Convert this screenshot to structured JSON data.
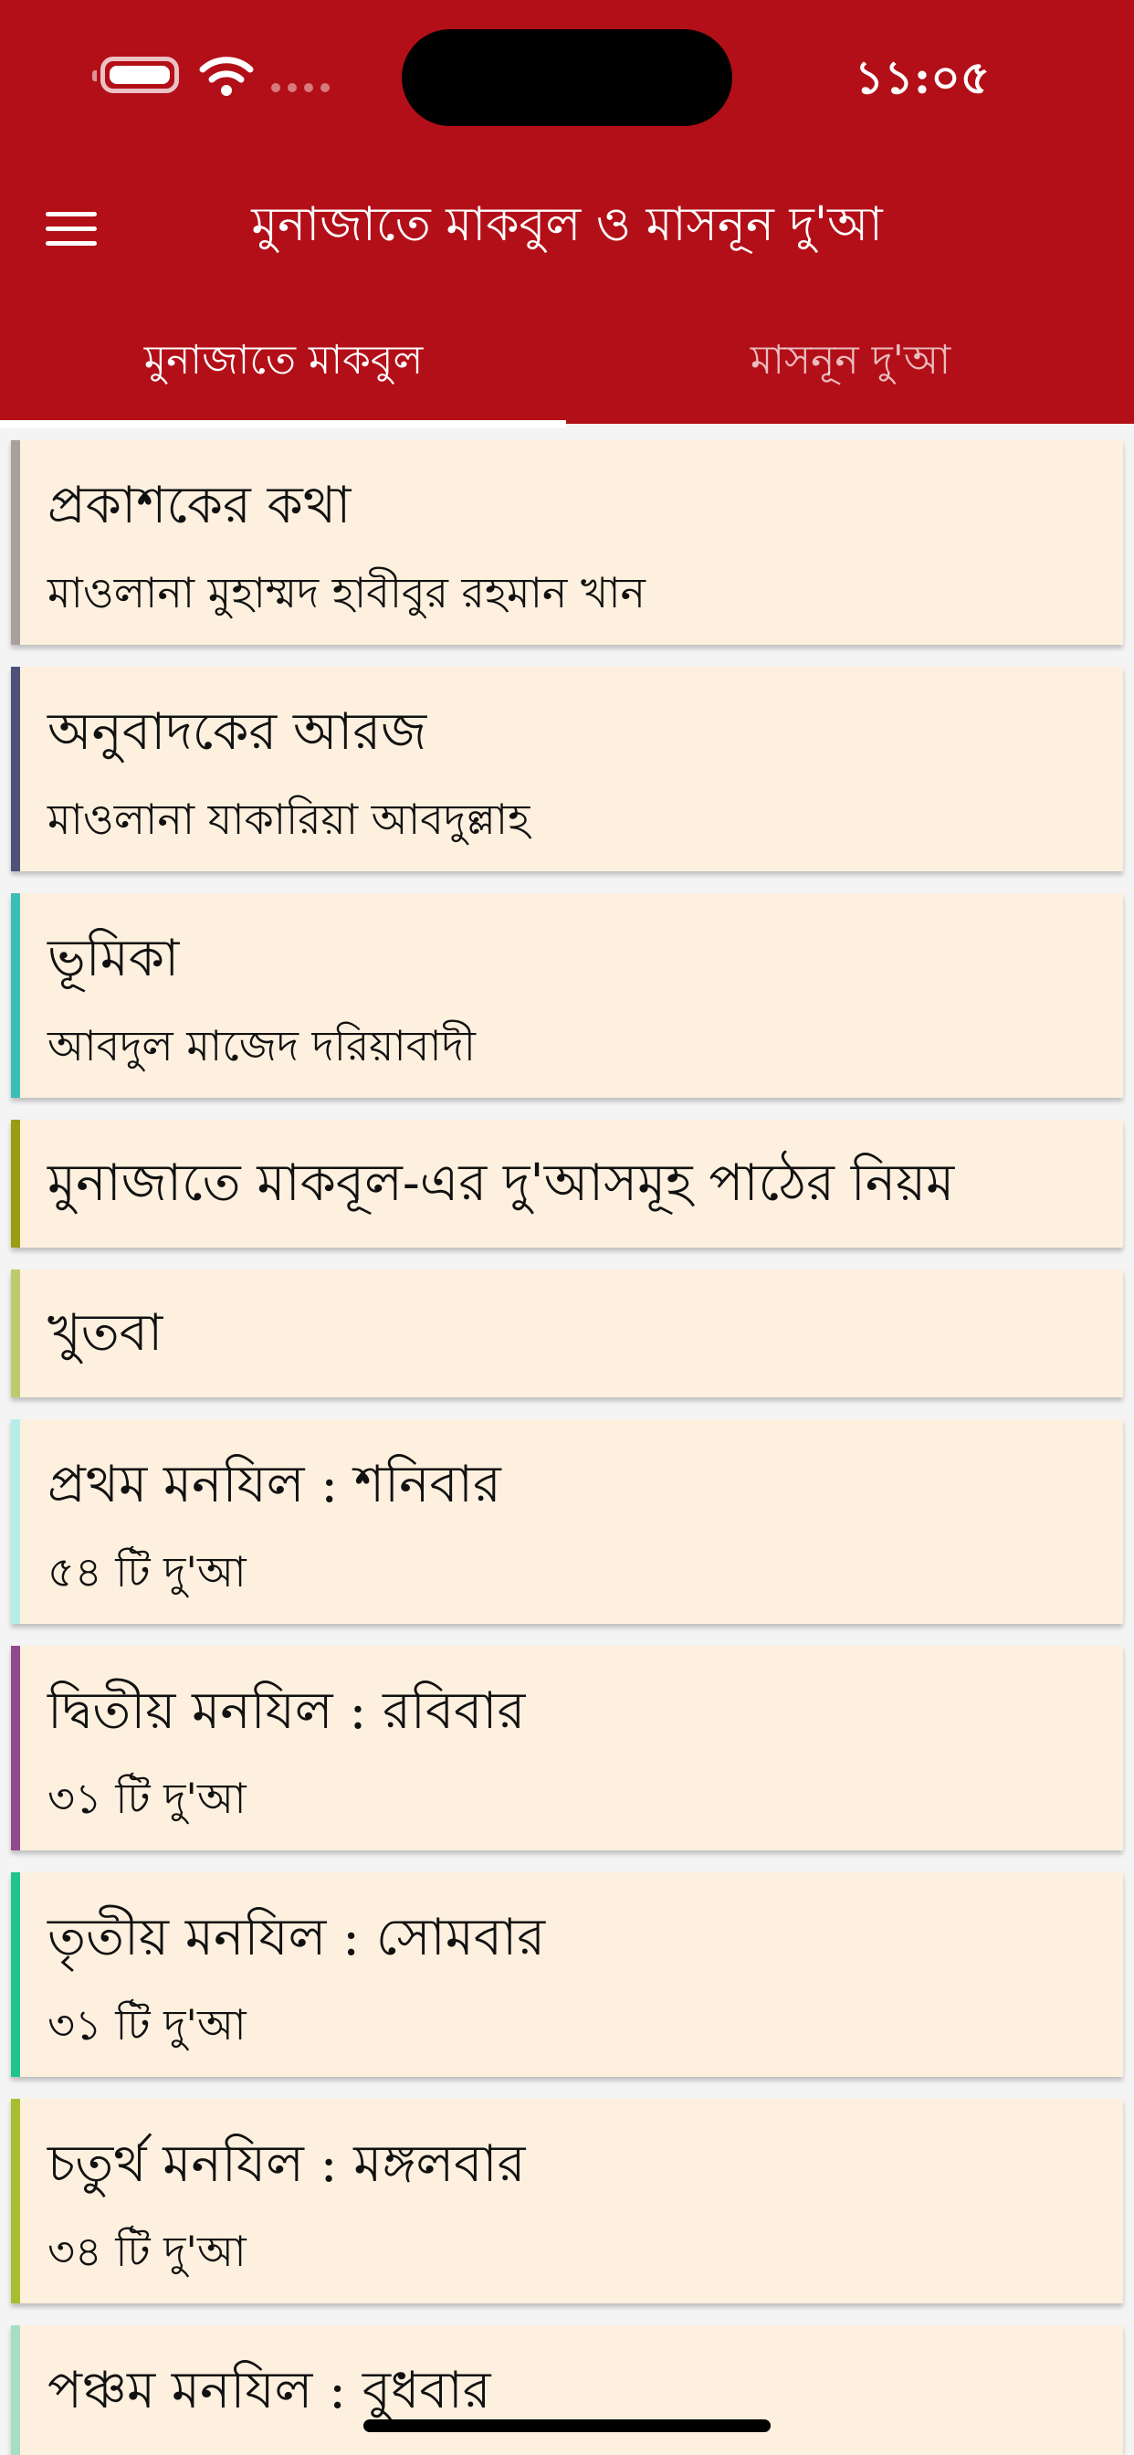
{
  "status_bar": {
    "time": "১১:০৫",
    "icons": [
      "battery-icon",
      "wifi-icon",
      "signal-icon"
    ]
  },
  "app_bar": {
    "title": "মুনাজাতে মাকবুল ও মাসনূন দু'আ",
    "menu_icon": "menu-icon",
    "background_color": "#B30F18"
  },
  "tabs": [
    {
      "label": "মুনাজাতে মাকবুল",
      "active": true
    },
    {
      "label": "মাসনূন দু'আ",
      "active": false
    }
  ],
  "chapters": [
    {
      "title": "প্রকাশকের কথা",
      "subtitle": "মাওলানা মুহাম্মদ হাবীবুর রহমান খান",
      "accent": "#A9A09B"
    },
    {
      "title": "অনুবাদকের আরজ",
      "subtitle": "মাওলানা যাকারিয়া আবদুল্লাহ",
      "accent": "#4E5279"
    },
    {
      "title": "ভূমিকা",
      "subtitle": "আবদুল মাজেদ দরিয়াবাদী",
      "accent": "#3CBDB6"
    },
    {
      "title": "মুনাজাতে মাকবূল-এর দু'আসমূহ পাঠের নিয়ম",
      "subtitle": "",
      "accent": "#9A9C12"
    },
    {
      "title": "খুতবা",
      "subtitle": "",
      "accent": "#BDCB6C"
    },
    {
      "title": "প্রথম মনযিল : শনিবার",
      "subtitle": "৫৪ টি দু'আ",
      "accent": "#B3EEE9"
    },
    {
      "title": "দ্বিতীয় মনযিল : রবিবার",
      "subtitle": "৩১ টি দু'আ",
      "accent": "#8E4A8C"
    },
    {
      "title": "তৃতীয় মনযিল : সোমবার",
      "subtitle": "৩১ টি দু'আ",
      "accent": "#1FC491"
    },
    {
      "title": "চতুর্থ মনযিল : মঙ্গলবার",
      "subtitle": "৩৪ টি দু'আ",
      "accent": "#A8BE2E"
    },
    {
      "title": "পঞ্চম মনযিল : বুধবার",
      "subtitle": "",
      "accent": "#A7DCC5"
    }
  ]
}
